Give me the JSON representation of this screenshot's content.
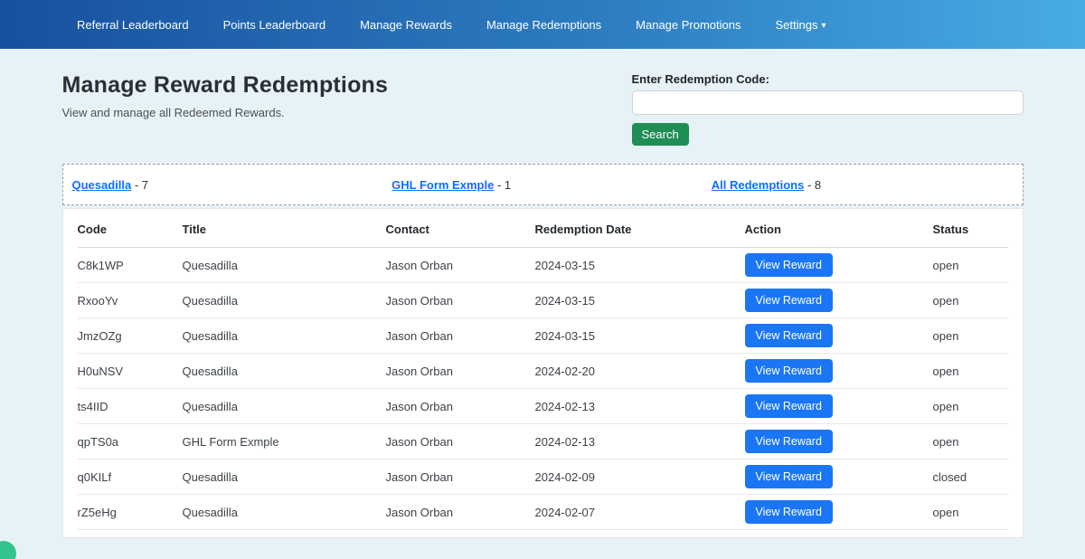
{
  "nav": {
    "items": [
      {
        "label": "Referral Leaderboard"
      },
      {
        "label": "Points Leaderboard"
      },
      {
        "label": "Manage Rewards"
      },
      {
        "label": "Manage Redemptions"
      },
      {
        "label": "Manage Promotions"
      },
      {
        "label": "Settings"
      }
    ],
    "settings_caret": "▾"
  },
  "header": {
    "title": "Manage Reward Redemptions",
    "subtitle": "View and manage all Redeemed Rewards."
  },
  "search": {
    "label": "Enter Redemption Code:",
    "input_value": "",
    "button_label": "Search"
  },
  "filters": {
    "separator": "-",
    "items": [
      {
        "label": "Quesadilla",
        "count": "7"
      },
      {
        "label": "GHL Form Exmple",
        "count": "1"
      },
      {
        "label": "All Redemptions",
        "count": "8"
      }
    ]
  },
  "table": {
    "columns": {
      "code": "Code",
      "title": "Title",
      "contact": "Contact",
      "date": "Redemption Date",
      "action": "Action",
      "status": "Status"
    },
    "action_label": "View Reward",
    "rows": [
      {
        "code": "C8k1WP",
        "title": "Quesadilla",
        "contact": "Jason Orban",
        "date": "2024-03-15",
        "status": "open"
      },
      {
        "code": "RxooYv",
        "title": "Quesadilla",
        "contact": "Jason Orban",
        "date": "2024-03-15",
        "status": "open"
      },
      {
        "code": "JmzOZg",
        "title": "Quesadilla",
        "contact": "Jason Orban",
        "date": "2024-03-15",
        "status": "open"
      },
      {
        "code": "H0uNSV",
        "title": "Quesadilla",
        "contact": "Jason Orban",
        "date": "2024-02-20",
        "status": "open"
      },
      {
        "code": "ts4IID",
        "title": "Quesadilla",
        "contact": "Jason Orban",
        "date": "2024-02-13",
        "status": "open"
      },
      {
        "code": "qpTS0a",
        "title": "GHL Form Exmple",
        "contact": "Jason Orban",
        "date": "2024-02-13",
        "status": "open"
      },
      {
        "code": "q0KILf",
        "title": "Quesadilla",
        "contact": "Jason Orban",
        "date": "2024-02-09",
        "status": "closed"
      },
      {
        "code": "rZ5eHg",
        "title": "Quesadilla",
        "contact": "Jason Orban",
        "date": "2024-02-07",
        "status": "open"
      }
    ]
  },
  "colors": {
    "navbar_gradient_start": "#17519e",
    "navbar_gradient_end": "#47ace4",
    "page_background": "#e7f2f7",
    "link_blue": "#0d6efd",
    "search_button_green": "#1e8e55",
    "action_button_blue": "#1b76f5",
    "chat_bubble_green": "#31c48d"
  }
}
